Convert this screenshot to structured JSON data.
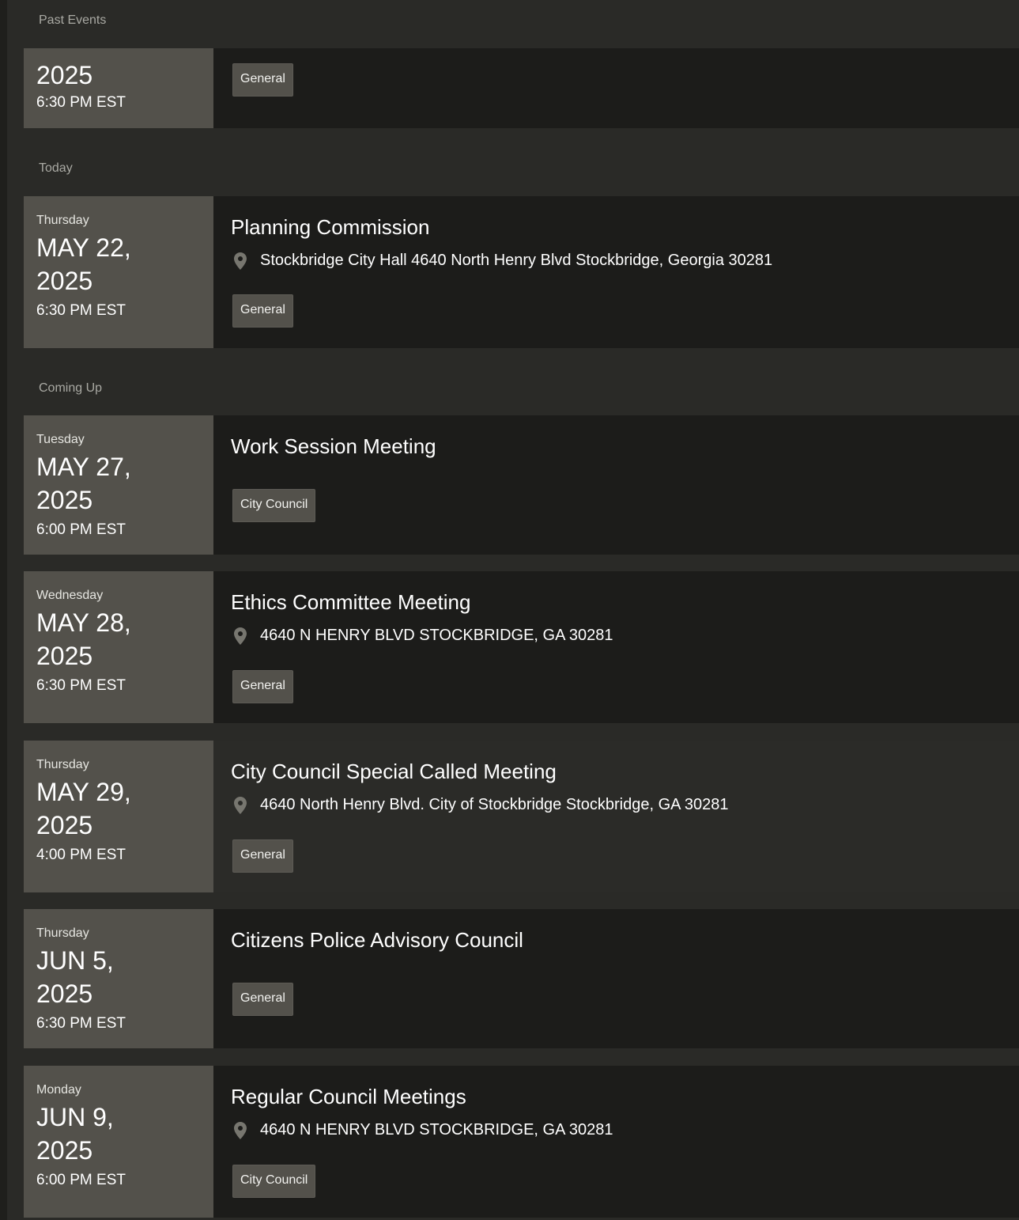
{
  "sections": {
    "past": "Past Events",
    "today": "Today",
    "coming": "Coming Up"
  },
  "past_event": {
    "year": "2025",
    "time": "6:30 PM EST",
    "tag": "General"
  },
  "events": [
    {
      "weekday": "Thursday",
      "date_line1": "MAY 22,",
      "date_line2": "2025",
      "time": "6:30 PM EST",
      "title": "Planning Commission",
      "location": "Stockbridge City Hall 4640 North Henry Blvd Stockbridge, Georgia 30281",
      "tag": "General"
    },
    {
      "weekday": "Tuesday",
      "date_line1": "MAY 27,",
      "date_line2": "2025",
      "time": "6:00 PM EST",
      "title": "Work Session Meeting",
      "location": "",
      "tag": "City Council"
    },
    {
      "weekday": "Wednesday",
      "date_line1": "MAY 28,",
      "date_line2": "2025",
      "time": "6:30 PM EST",
      "title": "Ethics Committee Meeting",
      "location": "4640 N HENRY BLVD STOCKBRIDGE, GA 30281",
      "tag": "General"
    },
    {
      "weekday": "Thursday",
      "date_line1": "MAY 29,",
      "date_line2": "2025",
      "time": "4:00 PM EST",
      "title": "City Council Special Called Meeting",
      "location": "4640 North Henry Blvd. City of Stockbridge Stockbridge, GA 30281",
      "tag": "General"
    },
    {
      "weekday": "Thursday",
      "date_line1": "JUN 5,",
      "date_line2": "2025",
      "time": "6:30 PM EST",
      "title": "Citizens Police Advisory Council",
      "location": "",
      "tag": "General"
    },
    {
      "weekday": "Monday",
      "date_line1": "JUN 9,",
      "date_line2": "2025",
      "time": "6:00 PM EST",
      "title": "Regular Council Meetings",
      "location": "4640 N HENRY BLVD STOCKBRIDGE, GA 30281",
      "tag": "City Council"
    }
  ],
  "icons": {
    "location": "map-pin-icon"
  }
}
